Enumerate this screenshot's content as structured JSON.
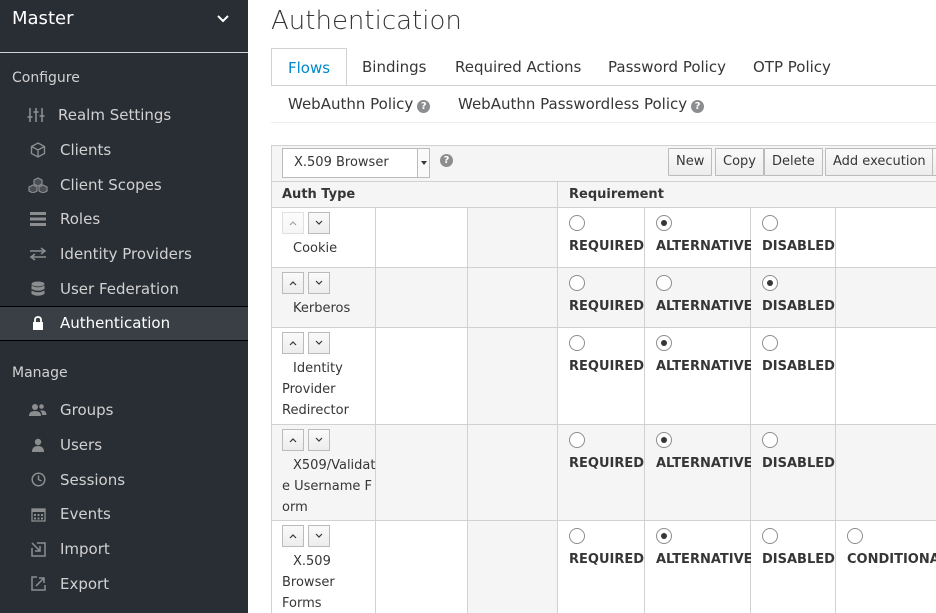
{
  "sidebar": {
    "realm": "Master",
    "configure_label": "Configure",
    "configure_items": [
      {
        "label": "Realm Settings",
        "icon": "sliders-icon"
      },
      {
        "label": "Clients",
        "icon": "cube-icon"
      },
      {
        "label": "Client Scopes",
        "icon": "cubes-icon"
      },
      {
        "label": "Roles",
        "icon": "list-icon"
      },
      {
        "label": "Identity Providers",
        "icon": "exchange-icon"
      },
      {
        "label": "User Federation",
        "icon": "database-icon"
      },
      {
        "label": "Authentication",
        "icon": "lock-icon",
        "active": true
      }
    ],
    "manage_label": "Manage",
    "manage_items": [
      {
        "label": "Groups",
        "icon": "users-icon"
      },
      {
        "label": "Users",
        "icon": "user-icon"
      },
      {
        "label": "Sessions",
        "icon": "clock-icon"
      },
      {
        "label": "Events",
        "icon": "calendar-icon"
      },
      {
        "label": "Import",
        "icon": "import-icon"
      },
      {
        "label": "Export",
        "icon": "export-icon"
      }
    ]
  },
  "main": {
    "title": "Authentication",
    "tabs": [
      {
        "label": "Flows",
        "active": true
      },
      {
        "label": "Bindings"
      },
      {
        "label": "Required Actions"
      },
      {
        "label": "Password Policy"
      },
      {
        "label": "OTP Policy"
      },
      {
        "label": "WebAuthn Policy",
        "help": true
      },
      {
        "label": "WebAuthn Passwordless Policy",
        "help": true
      }
    ],
    "toolbar": {
      "flow_select": "X.509 Browser",
      "new_label": "New",
      "copy_label": "Copy",
      "delete_label": "Delete",
      "add_execution_label": "Add execution"
    },
    "table": {
      "col_auth_type": "Auth Type",
      "col_requirement": "Requirement",
      "req_labels": {
        "required": "REQUIRED",
        "alternative": "ALTERNATIVE",
        "disabled": "DISABLED",
        "conditional": "CONDITIONAL"
      },
      "rows": [
        {
          "name": "Cookie",
          "selected": "ALTERNATIVE",
          "up_disabled": true
        },
        {
          "name": "Kerberos",
          "selected": "DISABLED"
        },
        {
          "name": "Identity Provider Redirector",
          "selected": "ALTERNATIVE"
        },
        {
          "name": "X509/Validate Username Form",
          "selected": "ALTERNATIVE"
        },
        {
          "name": "X.509 Browser Forms",
          "selected": "ALTERNATIVE",
          "conditional": true
        }
      ]
    }
  }
}
